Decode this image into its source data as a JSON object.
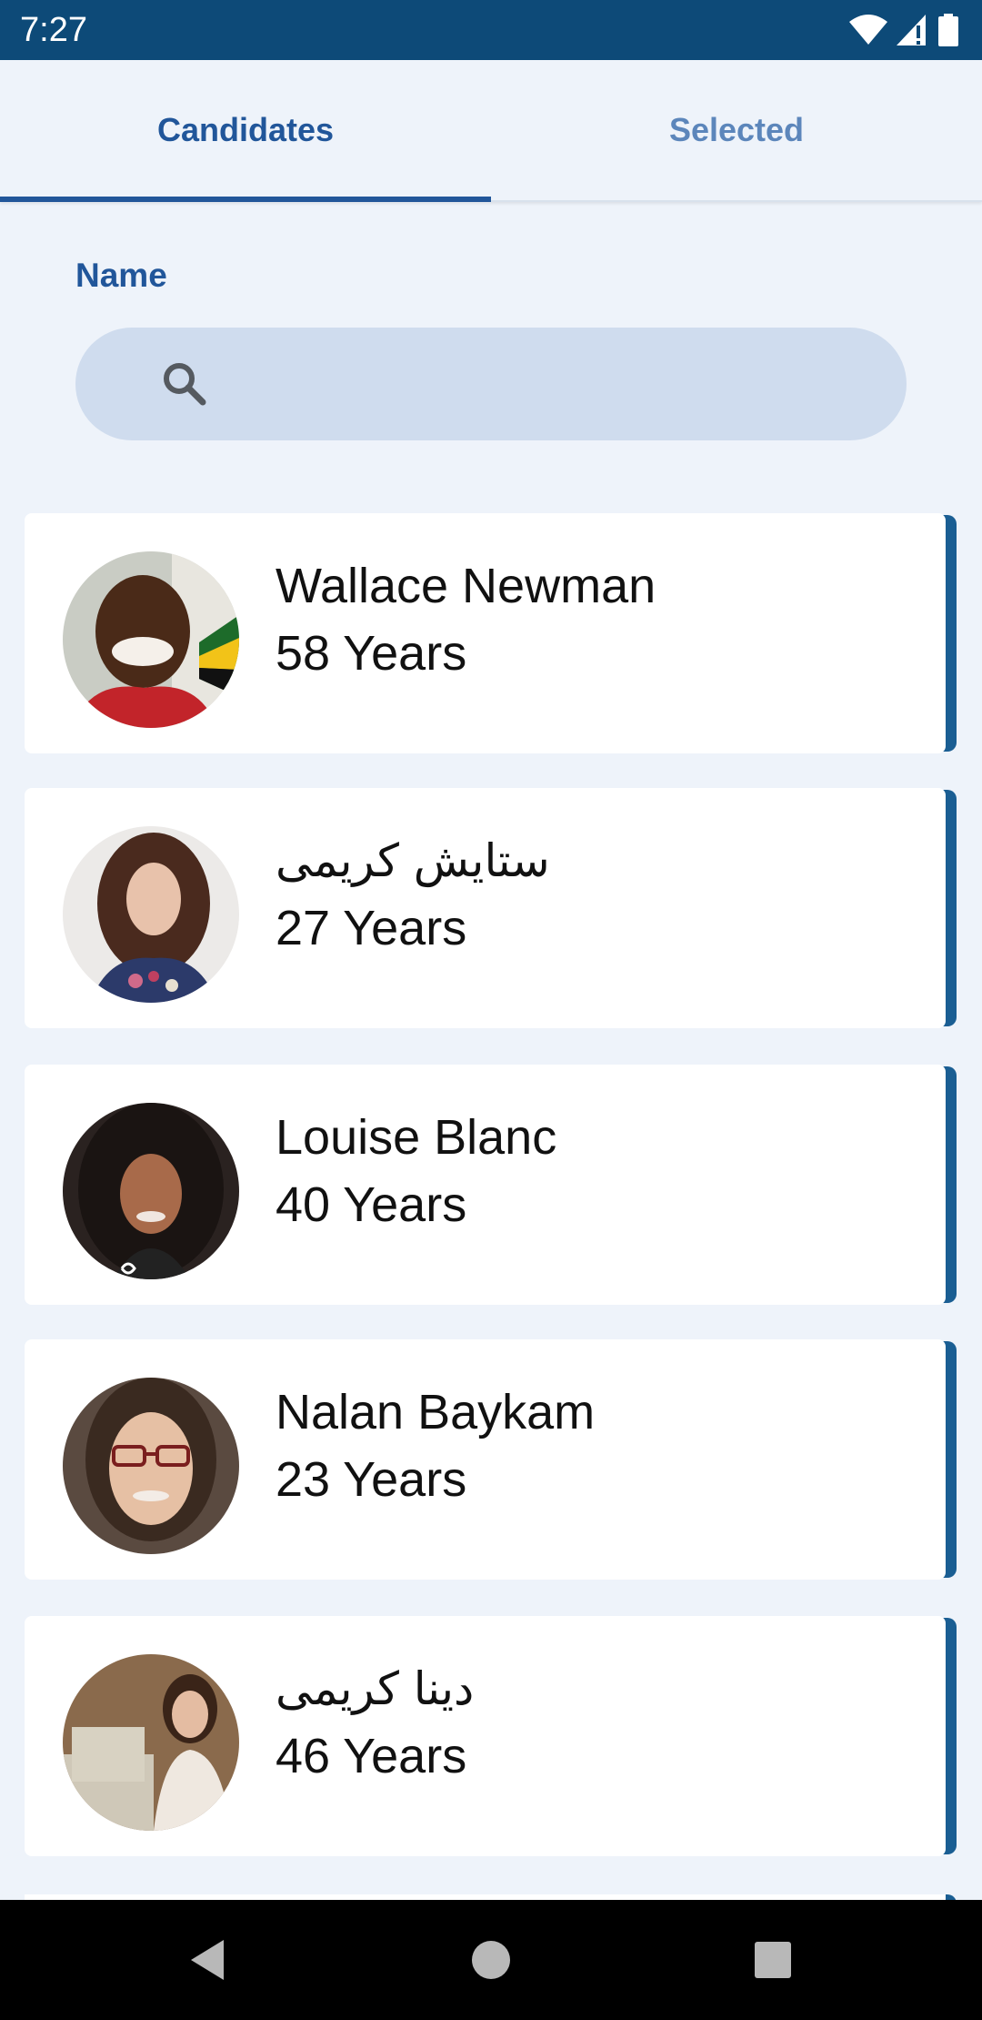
{
  "status_bar": {
    "time": "7:27",
    "icons": [
      "wifi-icon",
      "signal-icon",
      "battery-icon"
    ]
  },
  "tabs": [
    {
      "label": "Candidates",
      "active": true
    },
    {
      "label": "Selected",
      "active": false
    }
  ],
  "filter": {
    "name_label": "Name",
    "search_placeholder": "",
    "search_value": ""
  },
  "candidates": [
    {
      "name": "Wallace Newman",
      "age": "58 Years",
      "avatar": "avatar-man-smiling"
    },
    {
      "name": "ستایش کریمی",
      "age": "27 Years",
      "avatar": "avatar-woman-curly-hair"
    },
    {
      "name": "Louise Blanc",
      "age": "40 Years",
      "avatar": "avatar-woman-braids"
    },
    {
      "name": "Nalan Baykam",
      "age": "23 Years",
      "avatar": "avatar-woman-glasses"
    },
    {
      "name": "دینا کریمی",
      "age": "46 Years",
      "avatar": "avatar-woman-office"
    }
  ],
  "nav_bar": {
    "buttons": [
      "back-icon",
      "home-icon",
      "recents-icon"
    ]
  },
  "colors": {
    "primary": "#21569a",
    "status_bar": "#0d4a78",
    "card_border": "#1a5e93",
    "background": "#eef3fa",
    "search_bg": "#cfdcee"
  }
}
